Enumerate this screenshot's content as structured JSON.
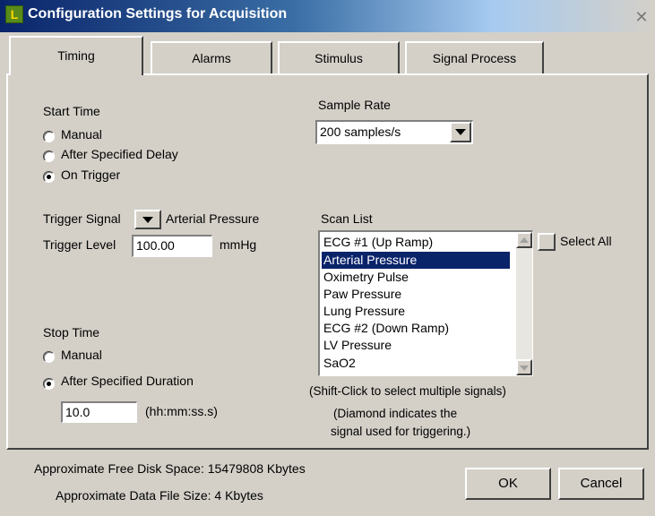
{
  "window": {
    "title": "Configuration Settings for Acquisition",
    "close_glyph": "✕",
    "app_icon": "L"
  },
  "tabs": [
    {
      "label": "Timing",
      "active": true
    },
    {
      "label": "Alarms"
    },
    {
      "label": "Stimulus"
    },
    {
      "label": "Signal Process"
    }
  ],
  "start_time": {
    "label": "Start Time",
    "options": [
      {
        "label": "Manual",
        "checked": false
      },
      {
        "label": "After Specified Delay",
        "checked": false
      },
      {
        "label": "On Trigger",
        "checked": true
      }
    ]
  },
  "sample_rate": {
    "label": "Sample Rate",
    "value": "200 samples/s"
  },
  "trigger": {
    "signal_label": "Trigger Signal",
    "signal_value": "Arterial Pressure",
    "level_label": "Trigger Level",
    "level_value": "100.00",
    "level_unit": "mmHg"
  },
  "scan_list": {
    "label": "Scan List",
    "items": [
      {
        "label": "ECG #1 (Up Ramp)",
        "selected": false
      },
      {
        "label": "Arterial Pressure",
        "selected": true
      },
      {
        "label": "Oximetry Pulse",
        "selected": false
      },
      {
        "label": "Paw Pressure",
        "selected": false
      },
      {
        "label": "Lung Pressure",
        "selected": false
      },
      {
        "label": "ECG #2 (Down Ramp)",
        "selected": false
      },
      {
        "label": "LV Pressure",
        "selected": false
      },
      {
        "label": "SaO2",
        "selected": false
      }
    ],
    "select_all_label": "Select All",
    "hint1": "(Shift-Click to select multiple signals)",
    "hint2_line1": "(Diamond indicates the",
    "hint2_line2": "signal used for triggering.)"
  },
  "stop_time": {
    "label": "Stop Time",
    "options": [
      {
        "label": "Manual",
        "checked": false
      },
      {
        "label": "After Specified Duration",
        "checked": true
      }
    ],
    "duration_value": "10.0",
    "duration_unit": "(hh:mm:ss.s)"
  },
  "footer": {
    "disk_space": "Approximate Free Disk Space:  15479808  Kbytes",
    "file_size": "Approximate Data File Size:  4  Kbytes",
    "ok_label": "OK",
    "cancel_label": "Cancel"
  }
}
